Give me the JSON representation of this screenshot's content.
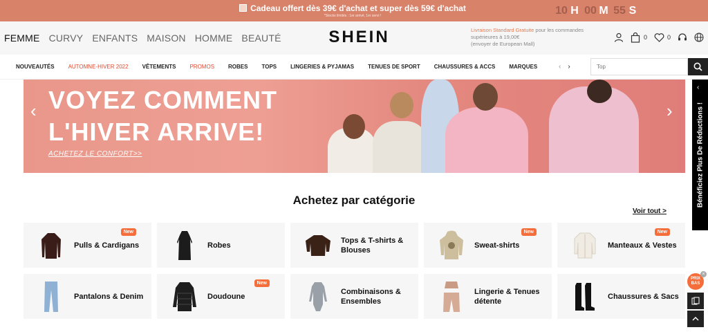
{
  "promo": {
    "message": "Cadeau offert dès 39€ d'achat et super dès 59€ d'achat",
    "sub": "*Stocks limités : 1er arrivé, 1er servi !",
    "timer": {
      "hours": "10",
      "h": "H",
      "minutes": "00",
      "m": "M",
      "seconds": "55",
      "s": "S"
    }
  },
  "header": {
    "gender_tabs": [
      "FEMME",
      "CURVY",
      "ENFANTS",
      "MAISON",
      "HOMME",
      "BEAUTÉ"
    ],
    "logo": "SHEIN",
    "shipping_highlight": "Livraison Standard Gratuite",
    "shipping_text": " pour les commandes supérieures à 19,00€",
    "shipping_sub": "(envoyer de European Mall)",
    "cart_count": "0",
    "wishlist_count": "0"
  },
  "nav": {
    "items": [
      "NOUVEAUTÉS",
      "AUTOMNE-HIVER 2022",
      "VÊTEMENTS",
      "PROMOS",
      "ROBES",
      "TOPS",
      "LINGERIES & PYJAMAS",
      "TENUES DE SPORT",
      "CHAUSSURES & ACCS",
      "MARQUES"
    ],
    "search_placeholder": "Top"
  },
  "banner": {
    "line1": "VOYEZ COMMENT",
    "line2": "L'HIVER ARRIVE!",
    "link": "ACHETEZ LE CONFORT>>"
  },
  "side_tab": "Bénéficiez Plus De Réductions !",
  "categories": {
    "title": "Achetez par catégorie",
    "see_all": "Voir tout >",
    "items": [
      {
        "label": "Pulls & Cardigans",
        "badge": "New"
      },
      {
        "label": "Robes",
        "badge": ""
      },
      {
        "label": "Tops & T-shirts & Blouses",
        "badge": ""
      },
      {
        "label": "Sweat-shirts",
        "badge": "New"
      },
      {
        "label": "Manteaux & Vestes",
        "badge": "New"
      },
      {
        "label": "Pantalons & Denim",
        "badge": ""
      },
      {
        "label": "Doudoune",
        "badge": "New"
      },
      {
        "label": "Combinaisons & Ensembles",
        "badge": ""
      },
      {
        "label": "Lingerie & Tenues détente",
        "badge": ""
      },
      {
        "label": "Chaussures & Sacs",
        "badge": ""
      }
    ]
  },
  "float": {
    "prix_bas": "PRIX BAS",
    "close": "×"
  },
  "colors": {
    "promo_bg": "#d9826a",
    "accent": "#f46d3b",
    "nav_red": "#e0492e"
  }
}
